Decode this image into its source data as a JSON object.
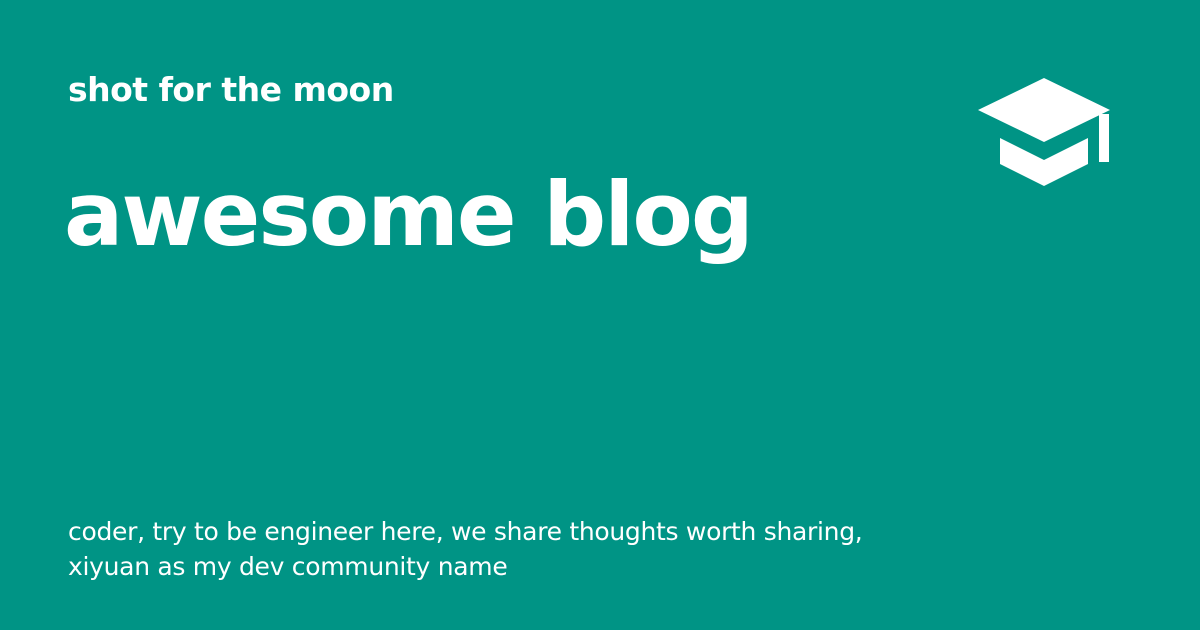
{
  "card": {
    "tagline": "shot for the moon",
    "title": "awesome blog",
    "description_lines": [
      "coder, try to be engineer here, we share thoughts worth sharing,",
      "xiyuan as my dev community name"
    ],
    "logo_icon": "graduation-cap-icon"
  },
  "colors": {
    "background": "#009485",
    "foreground": "#ffffff"
  }
}
